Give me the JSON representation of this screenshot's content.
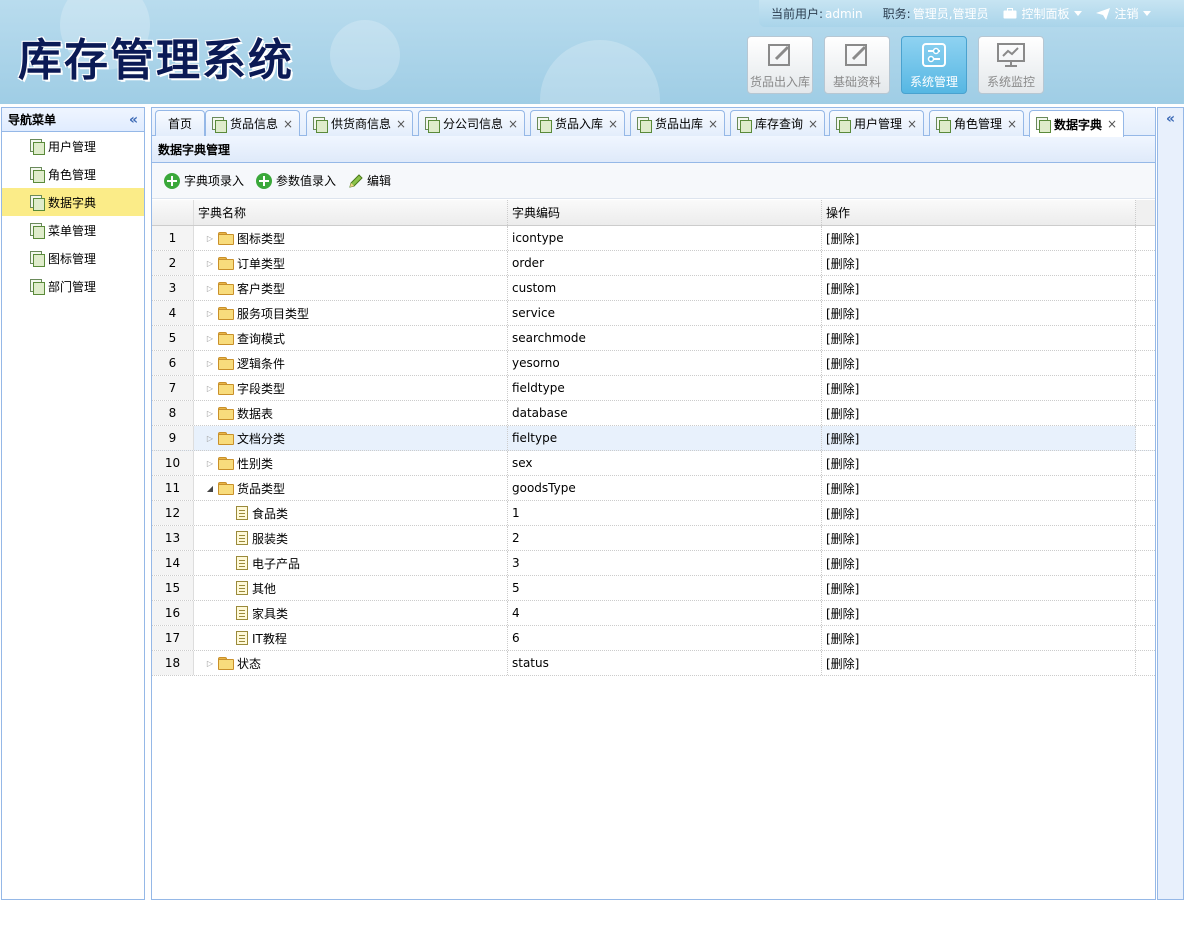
{
  "app": {
    "title": "库存管理系统"
  },
  "userbar": {
    "user_label": "当前用户:",
    "user_value": "admin",
    "role_label": "职务:",
    "role_value": "管理员,管理员",
    "panel_label": "控制面板",
    "logout_label": "注销"
  },
  "modules": [
    {
      "label": "货品出入库",
      "icon": "edit-icon",
      "active": false
    },
    {
      "label": "基础资料",
      "icon": "edit-icon",
      "active": false
    },
    {
      "label": "系统管理",
      "icon": "settings-sliders-icon",
      "active": true
    },
    {
      "label": "系统监控",
      "icon": "monitor-icon",
      "active": false
    }
  ],
  "nav": {
    "title": "导航菜单",
    "items": [
      {
        "label": "用户管理",
        "selected": false
      },
      {
        "label": "角色管理",
        "selected": false
      },
      {
        "label": "数据字典",
        "selected": true
      },
      {
        "label": "菜单管理",
        "selected": false
      },
      {
        "label": "图标管理",
        "selected": false
      },
      {
        "label": "部门管理",
        "selected": false
      }
    ]
  },
  "tabs": [
    {
      "label": "首页",
      "closable": false,
      "icon": false
    },
    {
      "label": "货品信息",
      "closable": true,
      "icon": true
    },
    {
      "label": "供货商信息",
      "closable": true,
      "icon": true
    },
    {
      "label": "分公司信息",
      "closable": true,
      "icon": true
    },
    {
      "label": "货品入库",
      "closable": true,
      "icon": true
    },
    {
      "label": "货品出库",
      "closable": true,
      "icon": true
    },
    {
      "label": "库存查询",
      "closable": true,
      "icon": true
    },
    {
      "label": "用户管理",
      "closable": true,
      "icon": true
    },
    {
      "label": "角色管理",
      "closable": true,
      "icon": true
    },
    {
      "label": "数据字典",
      "closable": true,
      "icon": true,
      "active": true
    }
  ],
  "panel": {
    "title": "数据字典管理"
  },
  "toolbar": {
    "add_item_label": "字典项录入",
    "add_value_label": "参数值录入",
    "edit_label": "编辑"
  },
  "grid": {
    "headers": {
      "name": "字典名称",
      "code": "字典编码",
      "op": "操作"
    },
    "rows": [
      {
        "num": "1",
        "name": "图标类型",
        "code": "icontype",
        "op": "[删除]",
        "type": "folder"
      },
      {
        "num": "2",
        "name": "订单类型",
        "code": "order",
        "op": "[删除]",
        "type": "folder"
      },
      {
        "num": "3",
        "name": "客户类型",
        "code": "custom",
        "op": "[删除]",
        "type": "folder"
      },
      {
        "num": "4",
        "name": "服务项目类型",
        "code": "service",
        "op": "[删除]",
        "type": "folder"
      },
      {
        "num": "5",
        "name": "查询模式",
        "code": "searchmode",
        "op": "[删除]",
        "type": "folder"
      },
      {
        "num": "6",
        "name": "逻辑条件",
        "code": "yesorno",
        "op": "[删除]",
        "type": "folder"
      },
      {
        "num": "7",
        "name": "字段类型",
        "code": "fieldtype",
        "op": "[删除]",
        "type": "folder"
      },
      {
        "num": "8",
        "name": "数据表",
        "code": "database",
        "op": "[删除]",
        "type": "folder"
      },
      {
        "num": "9",
        "name": "文档分类",
        "code": "fieltype",
        "op": "[删除]",
        "type": "folder",
        "hover": true
      },
      {
        "num": "10",
        "name": "性别类",
        "code": "sex",
        "op": "[删除]",
        "type": "folder"
      },
      {
        "num": "11",
        "name": "货品类型",
        "code": "goodsType",
        "op": "[删除]",
        "type": "folder-open"
      },
      {
        "num": "12",
        "name": "食品类",
        "code": "1",
        "op": "[删除]",
        "type": "file"
      },
      {
        "num": "13",
        "name": "服装类",
        "code": "2",
        "op": "[删除]",
        "type": "file"
      },
      {
        "num": "14",
        "name": "电子产品",
        "code": "3",
        "op": "[删除]",
        "type": "file"
      },
      {
        "num": "15",
        "name": "其他",
        "code": "5",
        "op": "[删除]",
        "type": "file"
      },
      {
        "num": "16",
        "name": "家具类",
        "code": "4",
        "op": "[删除]",
        "type": "file"
      },
      {
        "num": "17",
        "name": "IT教程",
        "code": "6",
        "op": "[删除]",
        "type": "file"
      },
      {
        "num": "18",
        "name": "状态",
        "code": "status",
        "op": "[删除]",
        "type": "folder"
      }
    ]
  },
  "colors": {
    "accent": "#95b8e7",
    "selected_nav": "#fbec88",
    "active_module": "#56b7e3"
  }
}
